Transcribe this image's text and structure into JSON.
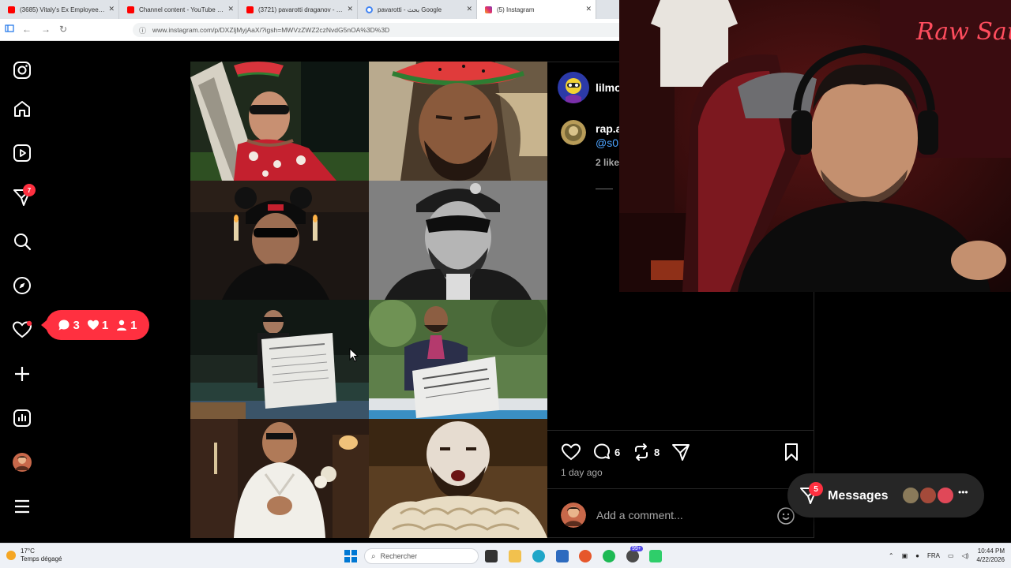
{
  "browser": {
    "tabs": [
      {
        "title": "(3685) Vitaly's Ex Employee Just",
        "icon": "youtube-icon",
        "color": "#ff0000"
      },
      {
        "title": "Channel content - YouTube Stu",
        "icon": "youtube-studio-icon",
        "color": "#ff0000"
      },
      {
        "title": "(3721) pavarotti draganov - You",
        "icon": "youtube-icon",
        "color": "#ff0000"
      },
      {
        "title": "pavarotti - بحث Google",
        "icon": "google-icon",
        "color": "#4285f4"
      },
      {
        "title": "(5) Instagram",
        "icon": "instagram-icon",
        "color": "#e1306c"
      }
    ],
    "url": "www.instagram.com/p/DXZljMyjAaX/?igsh=MWVzZWZ2czNvdG5nOA%3D%3D"
  },
  "sidebar": {
    "items": [
      {
        "name": "instagram-logo-icon"
      },
      {
        "name": "home-icon"
      },
      {
        "name": "reels-icon"
      },
      {
        "name": "messages-icon",
        "badge": "7"
      },
      {
        "name": "search-icon"
      },
      {
        "name": "explore-icon"
      },
      {
        "name": "notifications-icon"
      },
      {
        "name": "create-icon"
      },
      {
        "name": "dashboard-icon"
      },
      {
        "name": "profile-avatar"
      },
      {
        "name": "more-menu-icon"
      }
    ],
    "notification_pill": {
      "comments": "3",
      "likes": "1",
      "follows": "1"
    }
  },
  "post": {
    "author": "lilmo",
    "comment": {
      "user": "rap.a",
      "mention": "@s0",
      "likes": "2 like"
    },
    "actions": {
      "comments": "6",
      "reposts": "8"
    },
    "date": "1 day ago",
    "comment_placeholder": "Add a comment..."
  },
  "messages": {
    "label": "Messages",
    "badge": "5"
  },
  "taskbar": {
    "temperature": "17°C",
    "weather": "Temps dégagé",
    "search_placeholder": "Rechercher",
    "chat_badge": "99+",
    "language": "FRA",
    "time": "10:44 PM",
    "date": "4/22/2026"
  },
  "colors": {
    "accent_red": "#ff3040",
    "link_blue": "#4da3ff",
    "panel_border": "#262626"
  }
}
